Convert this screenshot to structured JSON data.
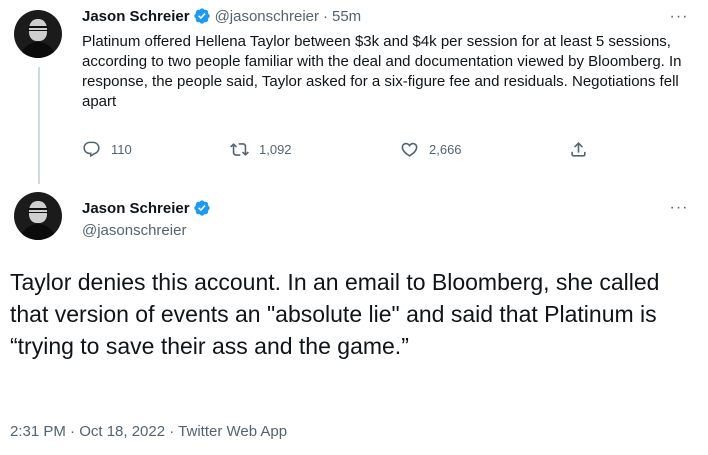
{
  "tweet1": {
    "author_name": "Jason Schreier",
    "handle": "@jasonschreier",
    "separator": "·",
    "time": "55m",
    "text": "Platinum offered Hellena Taylor between $3k and $4k per session for at least 5 sessions, according to two people familiar with the deal and documentation viewed by Bloomberg. In response, the people said, Taylor asked for a six-figure fee and residuals. Negotiations fell apart",
    "replies": "110",
    "retweets": "1,092",
    "likes": "2,666",
    "more": "···"
  },
  "tweet2": {
    "author_name": "Jason Schreier",
    "handle": "@jasonschreier",
    "more": "···",
    "text": "Taylor denies this account. In an email to Bloomberg, she called that version of events an \"absolute lie\" and said that Platinum is “trying to save their ass and the game.”",
    "timestamp": "2:31 PM · Oct 18, 2022",
    "separator": "·",
    "source": "Twitter Web App"
  },
  "icons": {
    "verified": "verified-badge-icon",
    "reply": "reply-icon",
    "retweet": "retweet-icon",
    "like": "heart-icon",
    "share": "share-icon",
    "more": "more-icon"
  },
  "colors": {
    "verified_blue": "#1d9bf0",
    "secondary_text": "#536471",
    "primary_text": "#0f1419",
    "thread_line": "#cfd9de"
  }
}
